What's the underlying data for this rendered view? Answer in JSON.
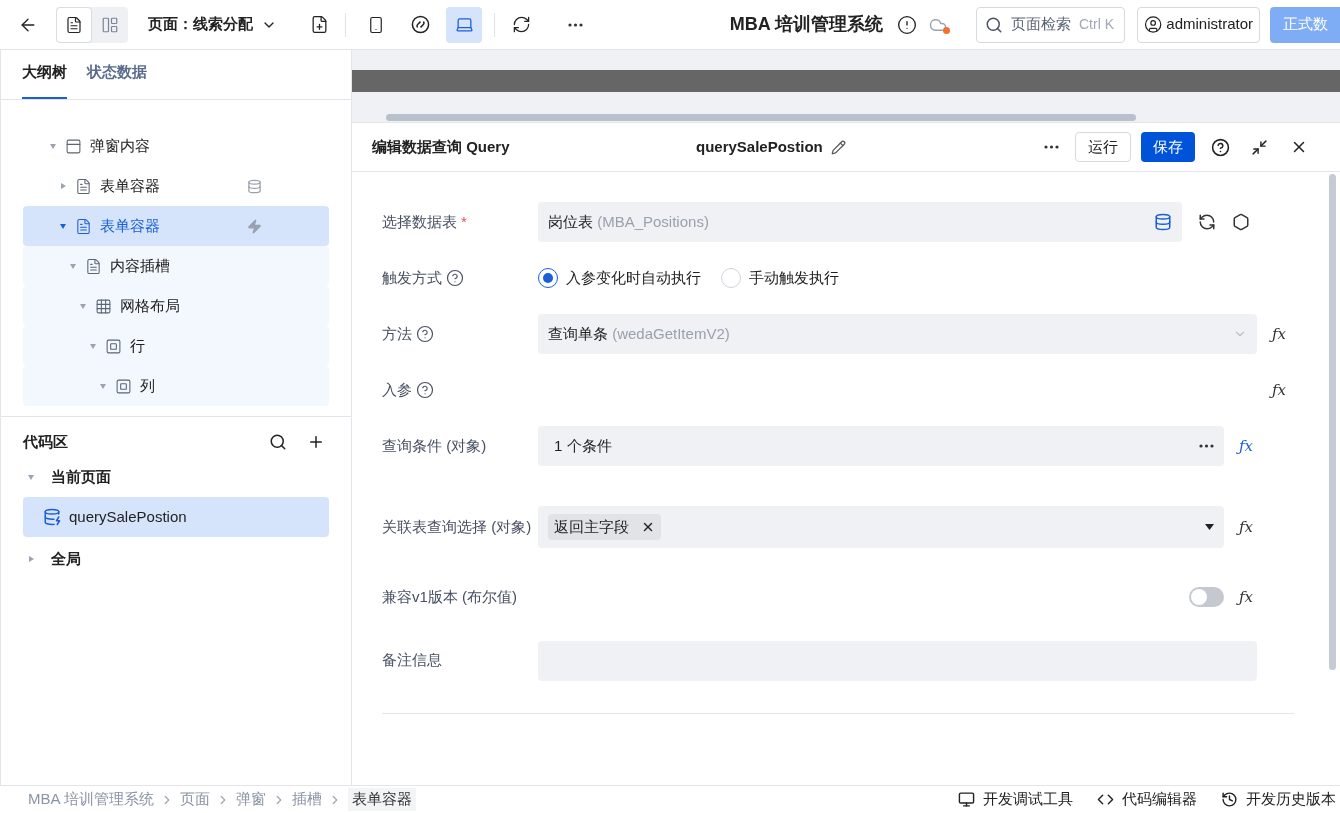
{
  "toolbar": {
    "views": [
      {
        "selected": true
      },
      {
        "selected": false
      }
    ],
    "page_title": "页面：线索分配",
    "devices": [
      {
        "kind": "mobile",
        "selected": false
      },
      {
        "kind": "miniprogram",
        "selected": false
      },
      {
        "kind": "desktop",
        "selected": true
      }
    ],
    "app_title": "MBA 培训管理系统",
    "search": {
      "placeholder": "页面检索",
      "shortcut": "Ctrl K"
    },
    "user": "administrator",
    "publish_button": "正式数"
  },
  "sidebar": {
    "tabs": [
      {
        "label": "大纲树",
        "selected": true
      },
      {
        "label": "状态数据",
        "selected": false
      }
    ],
    "tree": [
      {
        "label": "弹窗内容",
        "kind": "panel",
        "expanded": true,
        "selected": false,
        "children": [
          {
            "label": "表单容器",
            "kind": "form",
            "expanded": false,
            "selected": false,
            "badge": {
              "kind": "database"
            }
          },
          {
            "label": "表单容器",
            "kind": "form",
            "expanded": true,
            "selected": true,
            "badge": {
              "kind": "bolt"
            },
            "children": [
              {
                "label": "内容插槽",
                "kind": "form",
                "expanded": true,
                "selected": false,
                "children": [
                  {
                    "label": "网格布局",
                    "kind": "grid",
                    "expanded": true,
                    "selected": false,
                    "children": [
                      {
                        "label": "行",
                        "kind": "box",
                        "expanded": true,
                        "selected": false,
                        "children": [
                          {
                            "label": "列",
                            "kind": "box",
                            "expanded": true,
                            "selected": false
                          }
                        ]
                      }
                    ]
                  }
                ]
              }
            ]
          }
        ]
      }
    ],
    "code_area": {
      "title": "代码区",
      "groups": [
        {
          "label": "当前页面",
          "expanded": true,
          "items": [
            {
              "label": "querySalePostion",
              "selected": true
            }
          ]
        },
        {
          "label": "全局",
          "expanded": false
        }
      ]
    }
  },
  "editor": {
    "title": "编辑数据查询 Query",
    "query_name": "querySalePostion",
    "run_button": "运行",
    "save_button": "保存",
    "fields": [
      {
        "kind": "table",
        "label": "选择数据表",
        "required_mark": "*",
        "value": "岗位表",
        "hint": "(MBA_Positions)"
      },
      {
        "kind": "radio",
        "label": "触发方式",
        "help": true,
        "options": [
          {
            "label": "入参变化时自动执行",
            "selected": true
          },
          {
            "label": "手动触发执行",
            "selected": false
          }
        ]
      },
      {
        "kind": "select",
        "label": "方法",
        "help": true,
        "value": "查询单条",
        "hint": "(wedaGetItemV2)",
        "fx": "ƒx",
        "fx_active": false
      },
      {
        "kind": "params",
        "label": "入参",
        "help": true,
        "fx": "ƒx",
        "fx_active": false
      },
      {
        "kind": "condition",
        "label": "查询条件 (对象)",
        "value": "1 个条件",
        "fx": "ƒx",
        "fx_active": true
      },
      {
        "kind": "tags",
        "label": "关联表查询选择 (对象)",
        "tags": [
          "返回主字段"
        ],
        "fx": "ƒx",
        "fx_active": false
      },
      {
        "kind": "switch",
        "label": "兼容v1版本 (布尔值)",
        "on": false,
        "fx": "ƒx",
        "fx_active": false
      },
      {
        "kind": "textarea",
        "label": "备注信息"
      }
    ]
  },
  "footer": {
    "breadcrumb": [
      "MBA 培训管理系统",
      "页面",
      "弹窗",
      "插槽",
      "表单容器"
    ],
    "tools": [
      {
        "kind": "debug",
        "label": "开发调试工具"
      },
      {
        "kind": "code",
        "label": "代码编辑器"
      },
      {
        "kind": "history",
        "label": "开发历史版本"
      }
    ]
  }
}
